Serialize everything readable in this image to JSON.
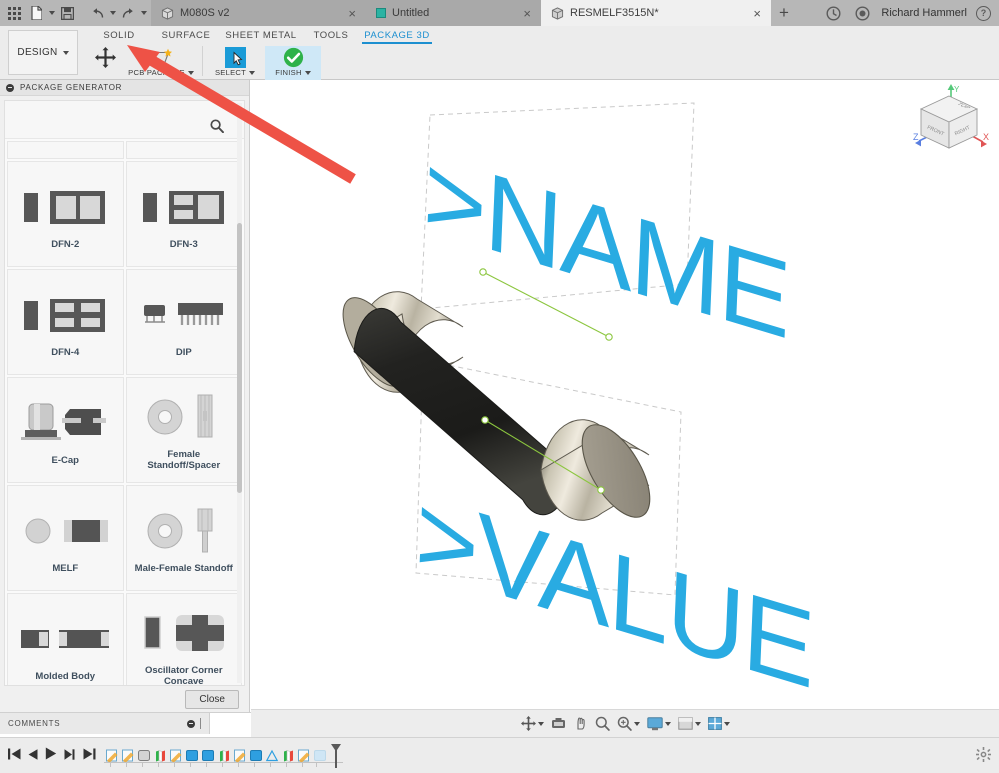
{
  "titlebar": {
    "icons": [
      {
        "name": "apps-grid-icon"
      },
      {
        "name": "new-document-icon"
      },
      {
        "name": "save-icon"
      },
      {
        "name": "undo-icon"
      },
      {
        "name": "redo-icon"
      }
    ],
    "tabs": [
      {
        "label": "M080S v2",
        "icon": "cube-icon",
        "active": false,
        "close": "×"
      },
      {
        "label": "Untitled",
        "icon": "square-icon",
        "active": false,
        "close": "×"
      },
      {
        "label": "RESMELF3515N*",
        "icon": "cube-icon",
        "active": true,
        "close": "×"
      }
    ],
    "new_tab_label": "+",
    "sync_icon": "sync-icon",
    "notifications_icon": "notifications-icon",
    "user_name": "Richard Hammerl",
    "help_icon": "help-icon",
    "help_glyph": "?"
  },
  "ribbon": {
    "design_label": "DESIGN",
    "tabs": [
      {
        "label": "SOLID",
        "selected": false
      },
      {
        "label": "SURFACE",
        "selected": false
      },
      {
        "label": "SHEET METAL",
        "selected": false
      },
      {
        "label": "TOOLS",
        "selected": false
      },
      {
        "label": "PACKAGE 3D",
        "selected": true
      }
    ],
    "commands": [
      {
        "label": "",
        "icon": "move-icon",
        "highlight": false,
        "has_caret": false
      },
      {
        "label": "PCB PACKAGE",
        "icon": "pcb-package-icon",
        "highlight": false,
        "has_caret": true
      },
      {
        "label": "SELECT",
        "icon": "select-cursor-icon",
        "highlight": false,
        "has_caret": true
      },
      {
        "label": "FINISH",
        "icon": "finish-check-icon",
        "highlight": true,
        "has_caret": true
      }
    ]
  },
  "panel": {
    "title": "PACKAGE GENERATOR",
    "collapse_icon": "collapse-icon",
    "search_icon": "search-icon",
    "close_label": "Close",
    "scrollbar": "panel-scrollbar",
    "packages": [
      {
        "label": "DFN-2",
        "art": "dfn2"
      },
      {
        "label": "DFN-3",
        "art": "dfn3"
      },
      {
        "label": "DFN-4",
        "art": "dfn4"
      },
      {
        "label": "DIP",
        "art": "dip"
      },
      {
        "label": "E-Cap",
        "art": "ecap"
      },
      {
        "label": "Female Standoff/Spacer",
        "art": "female-standoff"
      },
      {
        "label": "MELF",
        "art": "melf"
      },
      {
        "label": "Male-Female Standoff",
        "art": "male-female-standoff"
      },
      {
        "label": "Molded Body",
        "art": "molded-body"
      },
      {
        "label": "Oscillator Corner Concave",
        "art": "oscillator-corner-concave"
      }
    ]
  },
  "comments": {
    "label": "COMMENTS",
    "toggle_icon": "collapse-icon"
  },
  "viewport": {
    "model_name": "MELF resistor 3D model",
    "silkscreen_name_text": ">NAME",
    "silkscreen_value_text": ">VALUE",
    "silkscreen_color": "#29abe2",
    "sketch_line_color": "#8cc63f",
    "body_color": "#2b2b28",
    "cap_color": "#9a9487",
    "viewcube": {
      "top_label": "TOP",
      "front_label": "FRONT",
      "right_label": "RIGHT",
      "axis_x": "X",
      "axis_y": "Y",
      "axis_z": "Z",
      "axis_x_color": "#e05555",
      "axis_y_color": "#55c97a",
      "axis_z_color": "#5a7fe0"
    },
    "toolbar": [
      {
        "name": "orbit-icon",
        "caret": true
      },
      {
        "name": "look-at-icon",
        "caret": false
      },
      {
        "name": "pan-icon",
        "caret": false
      },
      {
        "name": "zoom-icon",
        "caret": false
      },
      {
        "name": "zoom-window-icon",
        "caret": true
      },
      {
        "name": "display-settings-icon",
        "caret": true
      },
      {
        "name": "visual-style-icon",
        "caret": true
      },
      {
        "name": "grid-layout-icon",
        "caret": true
      }
    ]
  },
  "timeline": {
    "nav": [
      {
        "name": "go-to-beginning-icon"
      },
      {
        "name": "step-back-icon"
      },
      {
        "name": "play-icon"
      },
      {
        "name": "step-forward-icon"
      },
      {
        "name": "go-to-end-icon"
      }
    ],
    "features": [
      {
        "name": "sketch-feature",
        "type": "sketch"
      },
      {
        "name": "sketch-feature",
        "type": "sketch"
      },
      {
        "name": "body-feature",
        "type": "body"
      },
      {
        "name": "pipe-feature",
        "type": "pipe"
      },
      {
        "name": "sketch-feature",
        "type": "sketch"
      },
      {
        "name": "extrude-feature",
        "type": "extrude"
      },
      {
        "name": "extrude-feature",
        "type": "extrude"
      },
      {
        "name": "pipe-feature",
        "type": "pipe"
      },
      {
        "name": "sketch-feature",
        "type": "sketch"
      },
      {
        "name": "extrude-feature",
        "type": "extrude"
      },
      {
        "name": "revolve-feature",
        "type": "revolve"
      },
      {
        "name": "pipe-feature",
        "type": "pipe"
      },
      {
        "name": "sketch-feature",
        "type": "sketch"
      },
      {
        "name": "pending-feature",
        "type": "pending"
      }
    ],
    "settings_icon": "gear-icon"
  },
  "annotation": {
    "arrow_color": "#ee5246",
    "arrow_name": "callout-arrow"
  }
}
